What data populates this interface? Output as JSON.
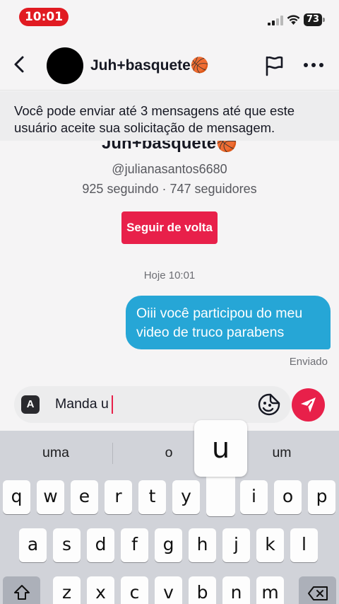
{
  "status_bar": {
    "time": "10:01",
    "battery": "73"
  },
  "header": {
    "title": "Juh+basquete🏀"
  },
  "banner": {
    "text": "Você pode enviar até 3 mensagens até que este usuário aceite sua solicitação de mensagem."
  },
  "profile": {
    "name": "Juh+basquete🏀",
    "handle": "@julianasantos6680",
    "stats": "925 seguindo · 747 seguidores",
    "follow_back_label": "Seguir de volta"
  },
  "chat": {
    "timestamp": "Hoje 10:01",
    "messages": [
      {
        "text": "Oiii você participou do meu video de truco parabens",
        "status": "Enviado"
      }
    ]
  },
  "input": {
    "value": "Manda u",
    "keyboard_toggle": "A"
  },
  "colors": {
    "accent": "#e8204a",
    "bubble": "#26a6d6",
    "time_pill": "#e11b22"
  },
  "keyboard": {
    "suggestions": [
      "uma",
      "o",
      "um"
    ],
    "popup_key": "u",
    "row1": [
      "q",
      "w",
      "e",
      "r",
      "t",
      "y",
      "u",
      "i",
      "o",
      "p"
    ],
    "row2": [
      "a",
      "s",
      "d",
      "f",
      "g",
      "h",
      "j",
      "k",
      "l"
    ],
    "row3": [
      "z",
      "x",
      "c",
      "v",
      "b",
      "n",
      "m"
    ]
  }
}
